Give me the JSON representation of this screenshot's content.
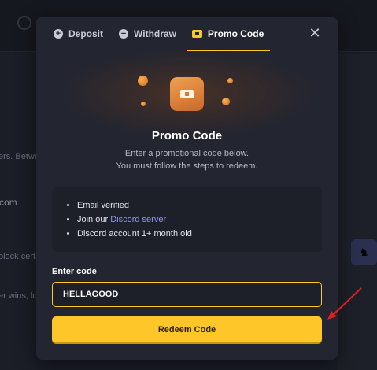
{
  "background": {
    "snippet_1": "ers. Betwee",
    "snippet_2": "com",
    "snippet_3": "block certa",
    "snippet_4": "er wins, los"
  },
  "modal": {
    "tabs": [
      {
        "label": "Deposit",
        "icon": "plus-circle-icon"
      },
      {
        "label": "Withdraw",
        "icon": "minus-circle-icon"
      },
      {
        "label": "Promo Code",
        "icon": "ticket-icon",
        "active": true
      }
    ],
    "close_icon": "close-icon",
    "title": "Promo Code",
    "subtitle_line1": "Enter a promotional code below.",
    "subtitle_line2": "You must follow the steps to redeem.",
    "requirements": {
      "item1": "Email verified",
      "item2_prefix": "Join our ",
      "item2_link": "Discord server",
      "item3": "Discord account 1+ month old"
    },
    "code_label": "Enter code",
    "code_value": "HELLAGOOD",
    "redeem_label": "Redeem Code"
  },
  "colors": {
    "accent": "#ffc629",
    "link": "#8f94ff",
    "annotation_arrow": "#e02020"
  }
}
